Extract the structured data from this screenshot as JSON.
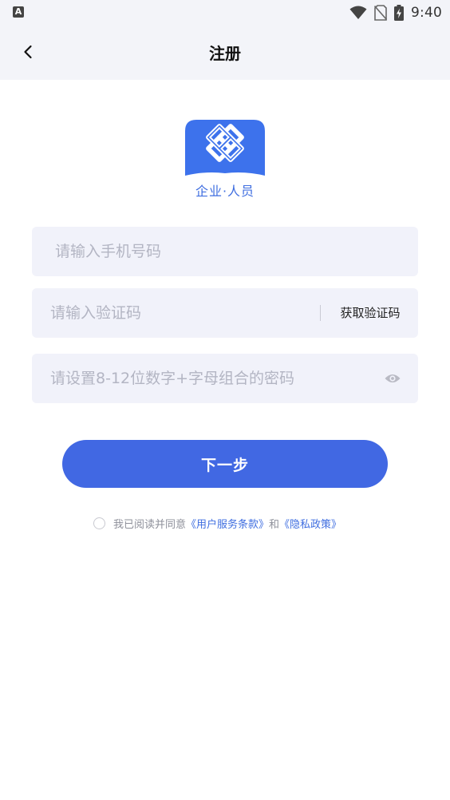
{
  "status_bar": {
    "app_icon_letter": "A",
    "time": "9:40",
    "icons": [
      "wifi-icon",
      "no-sim-icon",
      "battery-charging-icon"
    ]
  },
  "nav": {
    "title": "注册",
    "back_icon": "chevron-left-icon"
  },
  "logo": {
    "caption": "企业·人员",
    "color": "#3f6ee0"
  },
  "form": {
    "phone": {
      "value": "",
      "placeholder": "请输入手机号码"
    },
    "code": {
      "value": "",
      "placeholder": "请输入验证码",
      "get_code_label": "获取验证码"
    },
    "password": {
      "value": "",
      "placeholder": "请设置8-12位数字+字母组合的密码",
      "toggle_icon": "eye-icon"
    }
  },
  "next_button": {
    "label": "下一步",
    "color": "#4168e3"
  },
  "agreement": {
    "checked": false,
    "prefix": "我已阅读并同意",
    "terms_link": "《用户服务条款》",
    "conjunction": "和",
    "privacy_link": "《隐私政策》"
  }
}
